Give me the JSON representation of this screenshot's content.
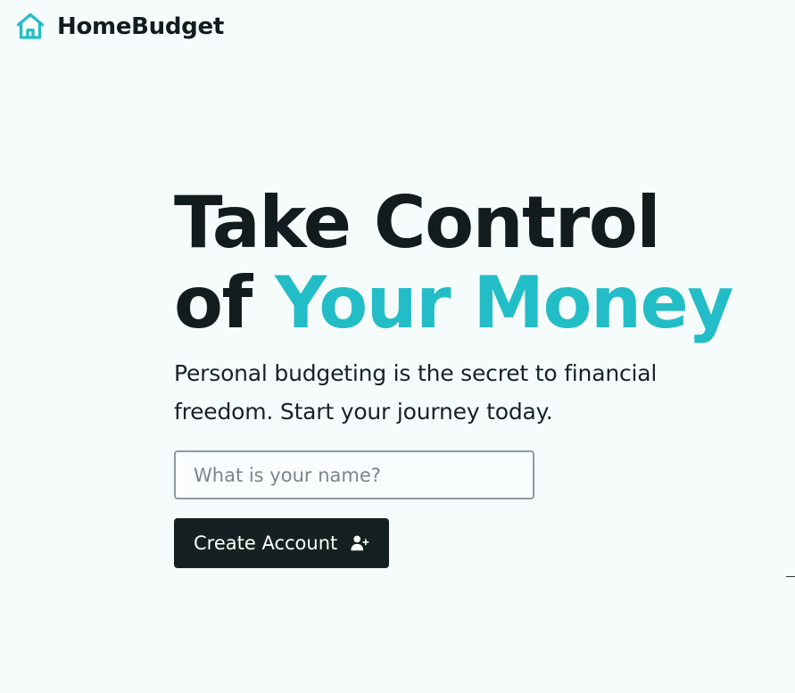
{
  "brand": {
    "name": "HomeBudget",
    "icon": "home-icon",
    "icon_color": "#22bdc6"
  },
  "hero": {
    "headline_line1": "Take Control",
    "headline_line2_prefix": "of ",
    "headline_line2_accent": "Your Money",
    "accent_color": "#22bdc6",
    "tagline": "Personal budgeting is the secret to financial freedom. Start your journey today."
  },
  "form": {
    "name_placeholder": "What is your name?",
    "name_value": "",
    "submit_label": "Create Account",
    "submit_icon": "user-plus-icon",
    "submit_bg": "#152022"
  }
}
